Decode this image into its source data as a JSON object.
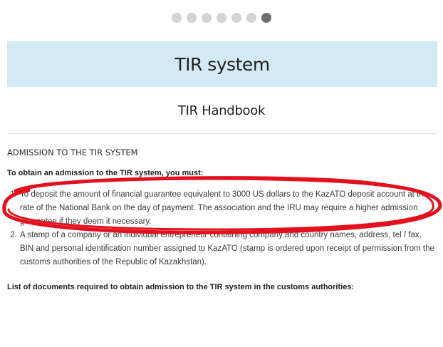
{
  "pager": {
    "total": 7,
    "active_index": 6
  },
  "header": {
    "title": "TIR system",
    "subtitle": "TIR Handbook"
  },
  "content": {
    "section_heading": "ADMISSION TO THE TIR SYSTEM",
    "lead": "To obtain an admission to the TIR system, you must:",
    "requirements": [
      "To deposit the amount of financial guarantee equivalent to 3000 US dollars to the KazATO deposit account at the rate of the National Bank on the day of payment. The association and the IRU may require a higher admission guarantee if they deem it necessary.",
      "A stamp of a company or an individual entrepreneur containing company and country names, address, tel / fax, BIN and personal identification number assigned to KazATO (stamp is ordered upon receipt of permission from the customs authorities of the Republic of Kazakhstan)."
    ],
    "documents_heading": "List of documents required to obtain admission to the TIR system in the customs authorities:"
  },
  "colors": {
    "title_band": "#d3e9f3",
    "dot_inactive": "#d4d4d4",
    "dot_active": "#6e6e6e",
    "highlight": "#e3101e"
  }
}
